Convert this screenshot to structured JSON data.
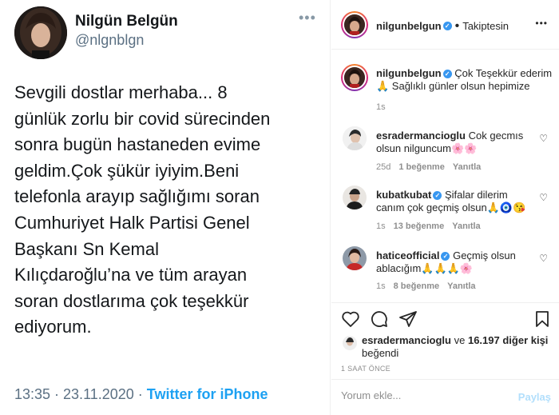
{
  "tweet": {
    "name": "Nilgün Belgün",
    "handle": "@nlgnblgn",
    "more": "•••",
    "lines": [
      "Sevgili dostlar merhaba... 8",
      "günlük zorlu bir covid sürecinden",
      "sonra bugün hastaneden evime",
      "geldim.Çok şükür iyiyim.Beni",
      "telefonla arayıp sağlığımı soran",
      "Cumhuriyet Halk Partisi Genel",
      "Başkanı  Sn Kemal",
      "Kılıçdaroğlu’na ve tüm arayan",
      "soran dostlarıma çok teşekkür",
      "ediyorum."
    ],
    "time": "13:35 · 23.11.2020 · ",
    "source": "Twitter for iPhone"
  },
  "instagram": {
    "header": {
      "username": "nilgunbelgun",
      "separator": "•",
      "follow_status": "Takiptesin",
      "more": "•••"
    },
    "caption": {
      "username": "nilgunbelgun",
      "text": "Çok Teşekkür ederim 🙏 Sağlıklı günler olsun hepimize",
      "time": "1s"
    },
    "comments": [
      {
        "username": "esradermancioglu",
        "verified": false,
        "text": "Cok gecmıs olsun nilguncum🌸🌸",
        "time": "25d",
        "likes": "1 beğenme",
        "reply": "Yanıtla"
      },
      {
        "username": "kubatkubat",
        "verified": true,
        "text": "Şifalar dilerim canım çok geçmiş olsun🙏🧿😘",
        "time": "1s",
        "likes": "13 beğenme",
        "reply": "Yanıtla"
      },
      {
        "username": "haticeofficial",
        "verified": true,
        "text": "Geçmiş olsun ablacığım🙏🙏🙏🌸",
        "time": "1s",
        "likes": "8 beğenme",
        "reply": "Yanıtla"
      }
    ],
    "liked_by": {
      "user": "esradermancioglu",
      "connector": " ve ",
      "others": "16.197 diğer kişi",
      "suffix": " beğendi"
    },
    "posted_ago": "1 SAAT ÖNCE",
    "comment_placeholder": "Yorum ekle...",
    "post_button": "Paylaş",
    "icons": [
      "heart-icon",
      "comment-icon",
      "share-icon",
      "save-icon"
    ]
  }
}
